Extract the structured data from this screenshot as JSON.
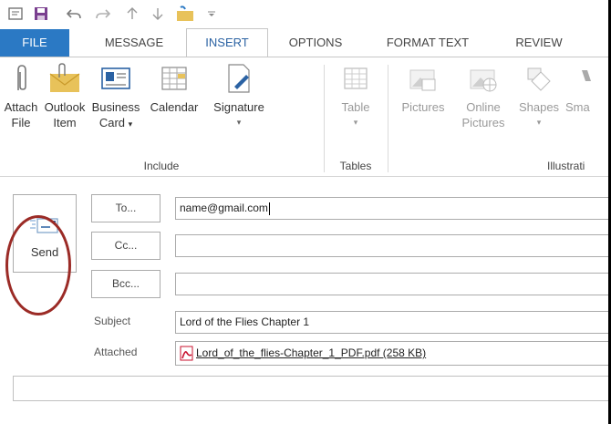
{
  "quick_access": {
    "icons": [
      "window-icon",
      "save-icon",
      "undo-icon",
      "redo-icon",
      "up-arrow-icon",
      "down-arrow-icon",
      "attach-icon",
      "more-icon"
    ]
  },
  "tabs": [
    {
      "label": "FILE",
      "state": "file"
    },
    {
      "label": "MESSAGE",
      "state": "normal"
    },
    {
      "label": "INSERT",
      "state": "active"
    },
    {
      "label": "OPTIONS",
      "state": "normal"
    },
    {
      "label": "FORMAT TEXT",
      "state": "normal"
    },
    {
      "label": "REVIEW",
      "state": "normal"
    }
  ],
  "ribbon": {
    "include": {
      "label": "Include",
      "attach_file": {
        "line1": "Attach",
        "line2": "File"
      },
      "outlook_item": {
        "line1": "Outlook",
        "line2": "Item"
      },
      "business_card": {
        "line1": "Business",
        "line2": "Card"
      },
      "calendar": {
        "line1": "Calendar"
      },
      "signature": {
        "line1": "Signature"
      }
    },
    "tables": {
      "label": "Tables",
      "table": {
        "line1": "Table"
      }
    },
    "illustrations": {
      "label": "Illustrati",
      "pictures": {
        "line1": "Pictures"
      },
      "online_pictures": {
        "line1": "Online",
        "line2": "Pictures"
      },
      "shapes": {
        "line1": "Shapes"
      },
      "smartart": {
        "line1": "Sma"
      }
    }
  },
  "compose": {
    "send_label": "Send",
    "to_label": "To...",
    "cc_label": "Cc...",
    "bcc_label": "Bcc...",
    "to_value": "name@gmail.com",
    "cc_value": "",
    "bcc_value": "",
    "subject_label": "Subject",
    "subject_value": "Lord of the Flies Chapter 1",
    "attached_label": "Attached",
    "attachment": "Lord_of_the_flies-Chapter_1_PDF.pdf (258 KB)"
  },
  "colors": {
    "file_tab": "#2b79c4",
    "active_tab_text": "#2b62a3",
    "annotation_ellipse": "#9b2b26",
    "pdf_red": "#c8102e"
  }
}
